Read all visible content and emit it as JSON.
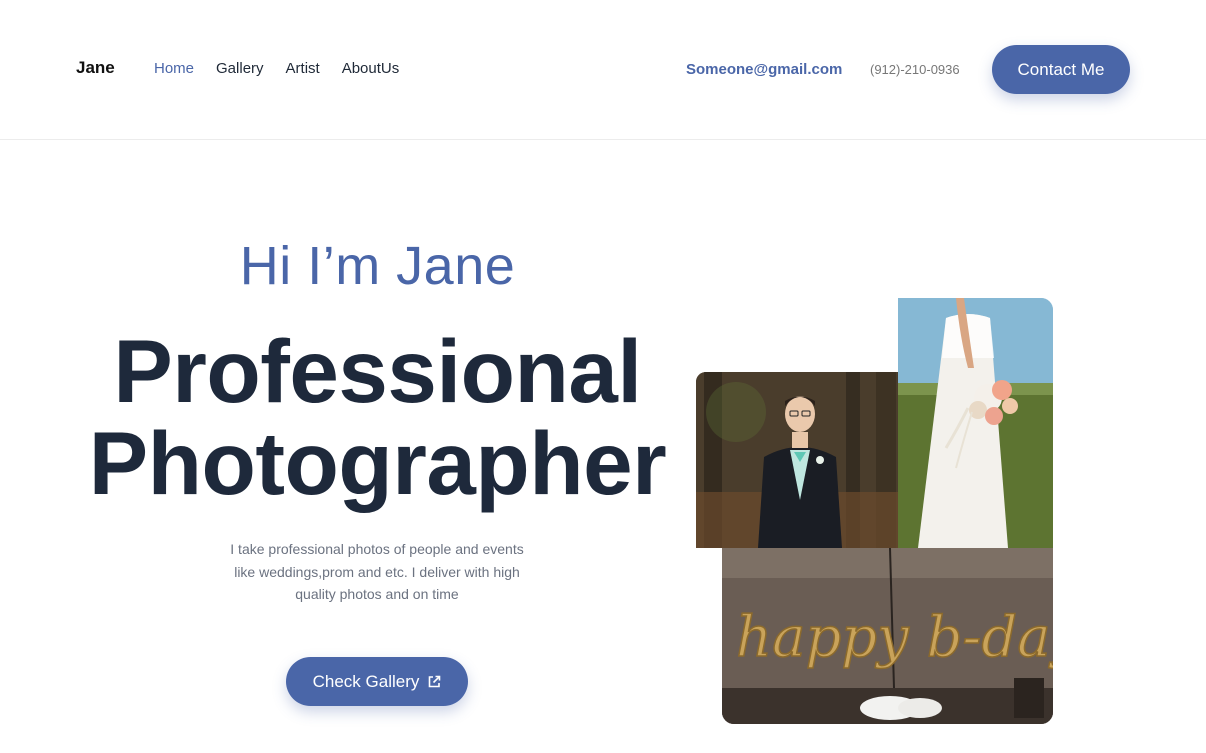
{
  "nav": {
    "brand": "Jane",
    "menu": [
      {
        "label": "Home",
        "active": true
      },
      {
        "label": "Gallery",
        "active": false
      },
      {
        "label": "Artist",
        "active": false
      },
      {
        "label": "AboutUs",
        "active": false
      }
    ],
    "email": "Someone@gmail.com",
    "phone": "(912)-210-0936",
    "contact_label": "Contact Me"
  },
  "hero": {
    "greeting": "Hi I’m Jane",
    "headline_line1": "Professional",
    "headline_line2": "Photographer",
    "description": "I take professional photos of people and events like weddings,prom and etc. I deliver with high quality photos and on time",
    "cta_label": "Check Gallery",
    "cta_icon": "external-link-icon"
  },
  "photos": {
    "prom": "prom-portrait-photo",
    "wedding": "bride-bouquet-photo",
    "birthday": "happy-bday-balloons-photo",
    "birthday_balloon_text": "happy b-day"
  },
  "colors": {
    "accent": "#4a66a8",
    "headline": "#1e293b",
    "body_text": "#6b7280"
  }
}
